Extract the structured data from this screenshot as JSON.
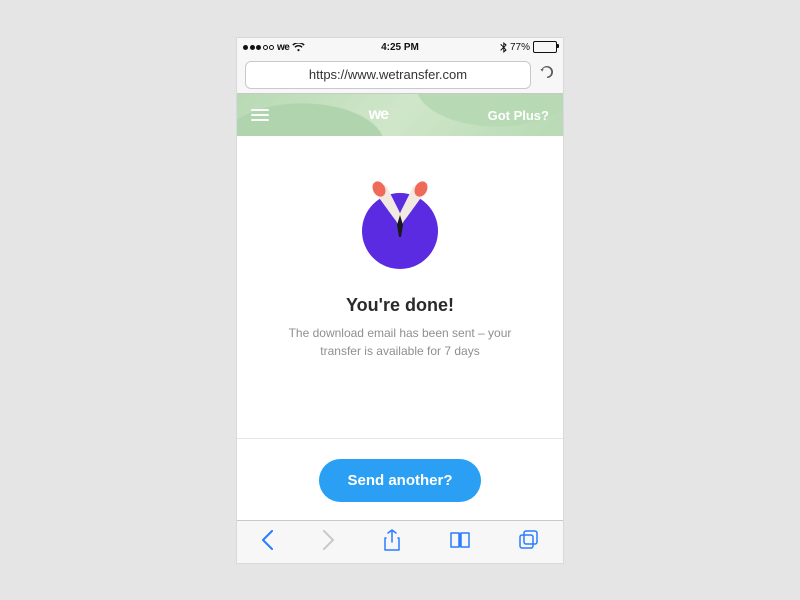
{
  "statusbar": {
    "carrier": "we",
    "time": "4:25 PM",
    "battery_pct": "77%"
  },
  "browser": {
    "url": "https://www.wetransfer.com"
  },
  "header": {
    "logo_text": "we",
    "plus_link": "Got Plus?"
  },
  "content": {
    "title": "You're done!",
    "subtitle": "The download email has been sent – your transfer is available for 7 days",
    "cta_label": "Send another?"
  },
  "icons": {
    "menu": "menu-icon",
    "reload": "reload-icon",
    "back": "chevron-left-icon",
    "forward": "chevron-right-icon",
    "share": "share-icon",
    "bookmarks": "book-icon",
    "tabs": "tabs-icon",
    "celebration": "arms-up-icon"
  },
  "colors": {
    "accent_blue": "#2a9ff4",
    "illus_purple": "#5a2be0",
    "hand": "#f06a5a",
    "body": "#f2e9e0"
  }
}
